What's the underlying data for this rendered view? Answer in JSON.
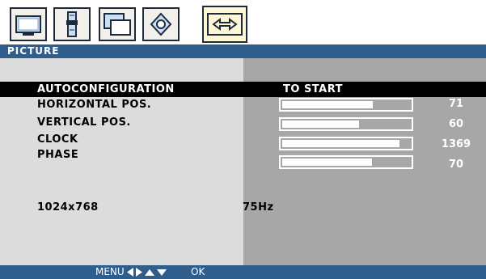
{
  "tabs": [
    {
      "icon": "monitor-picture-icon",
      "active": false
    },
    {
      "icon": "brightness-contrast-icon",
      "active": false
    },
    {
      "icon": "multi-window-icon",
      "active": false
    },
    {
      "icon": "settings-diamond-icon",
      "active": false
    },
    {
      "icon": "horizontal-arrows-icon",
      "active": true
    }
  ],
  "title": "PICTURE",
  "menu": {
    "autoconfig": {
      "label": "AUTOCONFIGURATION",
      "action": "TO START"
    },
    "items": [
      {
        "label": "HORIZONTAL POS.",
        "value": "71",
        "level": 0.71
      },
      {
        "label": "VERTICAL POS.",
        "value": "60",
        "level": 0.6
      },
      {
        "label": "CLOCK",
        "value": "1369",
        "level": 0.92
      },
      {
        "label": "PHASE",
        "value": "70",
        "level": 0.7
      }
    ]
  },
  "status": {
    "resolution": "1024x768",
    "refresh": "75Hz"
  },
  "footer": {
    "menu_label": "MENU",
    "ok_label": "OK"
  },
  "colors": {
    "title_bar": "#2f5d8c",
    "selection": "#000000",
    "left_panel": "#dcdcdc",
    "right_panel": "#a7a7a7"
  }
}
